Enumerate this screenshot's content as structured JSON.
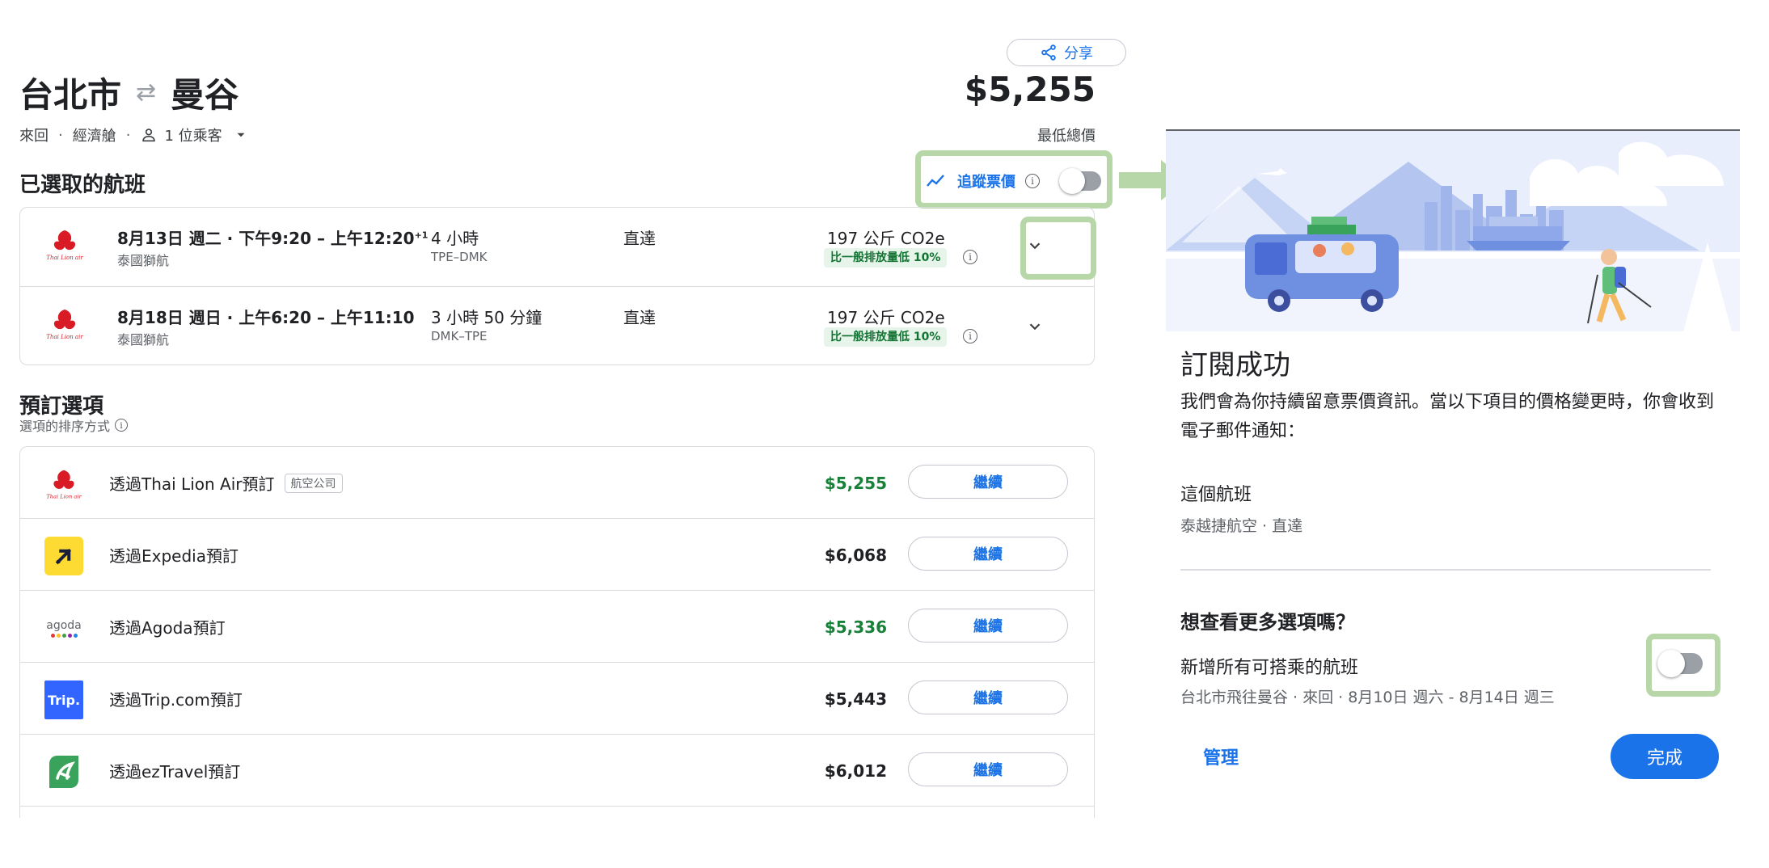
{
  "header": {
    "share_label": "分享",
    "origin": "台北市",
    "destination": "曼谷",
    "swap_symbol": "⇄",
    "total_price": "$5,255",
    "trip_type": "來回",
    "cabin": "經濟艙",
    "passengers": "1 位乘客",
    "lowest_label": "最低總價"
  },
  "selected_flights": {
    "title": "已選取的航班",
    "track_label": "追蹤票價",
    "track_on": false,
    "flights": [
      {
        "time": "8月13日 週二 · 下午9:20 – 上午12:20",
        "time_suffix": "+1",
        "airline": "泰國獅航",
        "duration": "4 小時",
        "route_code": "TPE–DMK",
        "stops": "直達",
        "co2": "197 公斤 CO2e",
        "emission_badge": "比一般排放量低 10%"
      },
      {
        "time": "8月18日 週日 · 上午6:20 – 上午11:10",
        "time_suffix": "",
        "airline": "泰國獅航",
        "duration": "3 小時 50 分鐘",
        "route_code": "DMK–TPE",
        "stops": "直達",
        "co2": "197 公斤 CO2e",
        "emission_badge": "比一般排放量低 10%"
      }
    ]
  },
  "booking": {
    "title": "預訂選項",
    "sort_label": "選項的排序方式",
    "options": [
      {
        "name": "透過Thai Lion Air預訂",
        "tag": "航空公司",
        "price": "$5,255",
        "price_color": "#188038",
        "button": "繼續",
        "logo": "thai-lion-air-logo"
      },
      {
        "name": "透過Expedia預訂",
        "tag": "",
        "price": "$6,068",
        "price_color": "#202124",
        "button": "繼續",
        "logo": "expedia-logo"
      },
      {
        "name": "透過Agoda預訂",
        "tag": "",
        "price": "$5,336",
        "price_color": "#188038",
        "button": "繼續",
        "logo": "agoda-logo",
        "logo_text": "agoda"
      },
      {
        "name": "透過Trip.com預訂",
        "tag": "",
        "price": "$5,443",
        "price_color": "#202124",
        "button": "繼續",
        "logo": "trip-com-logo",
        "logo_text": "Trip."
      },
      {
        "name": "透過ezTravel預訂",
        "tag": "",
        "price": "$6,012",
        "price_color": "#202124",
        "button": "繼續",
        "logo": "eztravel-logo"
      }
    ]
  },
  "dialog": {
    "title": "訂閱成功",
    "description": "我們會為你持續留意票價資訊。當以下項目的價格變更時，你會收到電子郵件通知：",
    "flight_title": "這個航班",
    "flight_sub": "泰越捷航空 · 直達",
    "more_title": "想查看更多選項嗎？",
    "add_title": "新增所有可搭乘的航班",
    "add_sub": "台北市飛往曼谷 · 來回 · 8月10日 週六 - 8月14日 週三",
    "add_toggle_on": false,
    "manage_label": "管理",
    "done_label": "完成"
  },
  "colors": {
    "accent": "#1a73e8",
    "highlight": "#b7d7a8",
    "price_green": "#188038",
    "emission_bg": "#e6f4ea"
  }
}
